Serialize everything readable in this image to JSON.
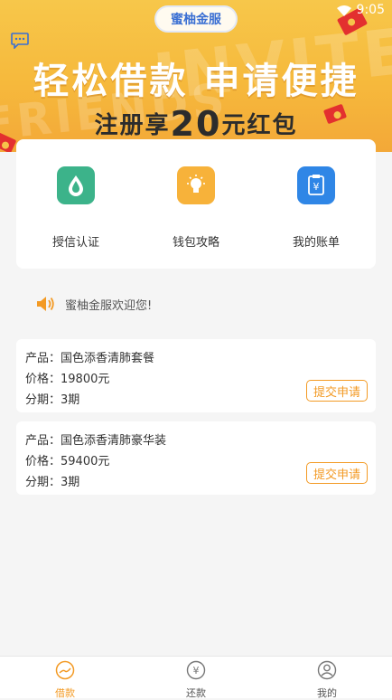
{
  "status_bar": {
    "time": "9:05"
  },
  "app": {
    "title": "蜜柚金服"
  },
  "banner": {
    "headline": "轻松借款 申请便捷",
    "sub_prefix": "注册享",
    "sub_amount": "20",
    "sub_suffix": "元红包"
  },
  "quick_links": [
    {
      "label": "授信认证",
      "icon": "drop-icon",
      "color": "#3cb38a"
    },
    {
      "label": "钱包攻略",
      "icon": "lightbulb-icon",
      "color": "#f7b23a"
    },
    {
      "label": "我的账单",
      "icon": "yen-bill-icon",
      "color": "#2f86e6"
    }
  ],
  "notice": {
    "text": "蜜柚金服欢迎您!"
  },
  "products": [
    {
      "product": "产品：国色添香清肺套餐",
      "price": "价格：19800元",
      "term": "分期：3期",
      "button": "提交申请"
    },
    {
      "product": "产品：国色添香清肺豪华装",
      "price": "价格：59400元",
      "term": "分期：3期",
      "button": "提交申请"
    }
  ],
  "bottom_nav": [
    {
      "label": "借款",
      "active": true
    },
    {
      "label": "还款",
      "active": false
    },
    {
      "label": "我的",
      "active": false
    }
  ],
  "colors": {
    "accent": "#f39a24",
    "banner": "#f6b93c"
  }
}
